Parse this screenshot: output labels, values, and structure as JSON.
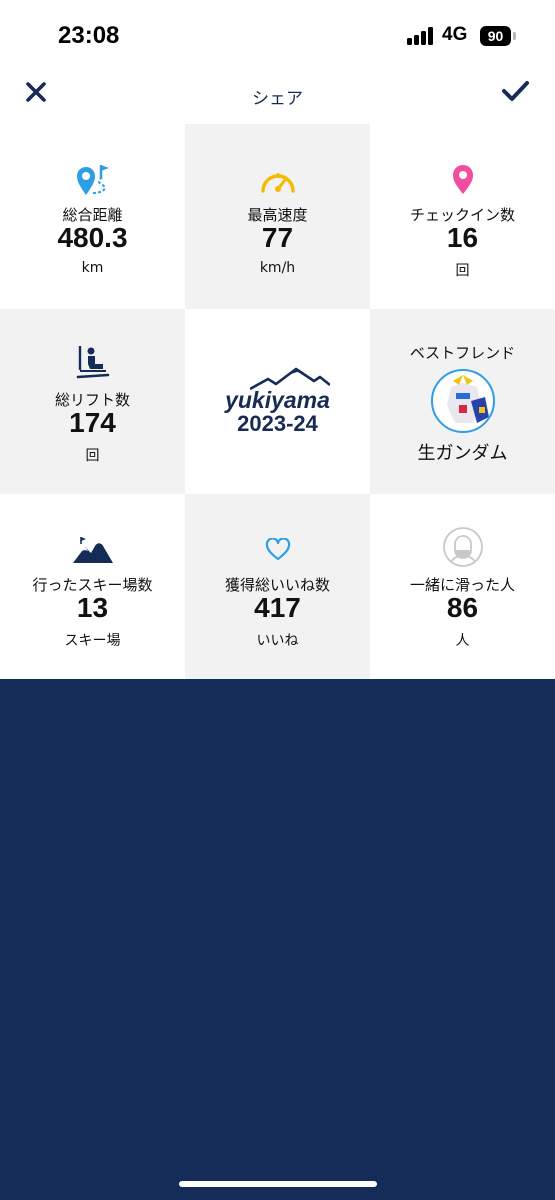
{
  "status_bar": {
    "time": "23:08",
    "network": "4G",
    "battery": "90"
  },
  "nav": {
    "title": "シェア",
    "close_icon": "close-icon",
    "done_icon": "checkmark-icon"
  },
  "stats": {
    "distance": {
      "label": "総合距離",
      "value": "480.3",
      "unit": "km",
      "icon": "route-pin-icon"
    },
    "top_speed": {
      "label": "最高速度",
      "value": "77",
      "unit": "km/h",
      "icon": "speedometer-icon"
    },
    "checkins": {
      "label": "チェックイン数",
      "value": "16",
      "unit": "回",
      "icon": "location-pin-icon"
    },
    "lifts": {
      "label": "総リフト数",
      "value": "174",
      "unit": "回",
      "icon": "ski-lift-icon"
    },
    "resorts": {
      "label": "行ったスキー場数",
      "value": "13",
      "unit": "スキー場",
      "icon": "mountain-icon"
    },
    "likes": {
      "label": "獲得総いいね数",
      "value": "417",
      "unit": "いいね",
      "icon": "heart-icon"
    },
    "companions": {
      "label": "一緒に滑った人",
      "value": "86",
      "unit": "人",
      "icon": "person-icon"
    }
  },
  "logo": {
    "brand": "yukiyama",
    "season": "2023-24"
  },
  "best_friend": {
    "label": "ベストフレンド",
    "name": "生ガンダム"
  },
  "colors": {
    "navy": "#162c58",
    "blue": "#2e9fe6",
    "yellow": "#f6b800",
    "pink": "#ee4da0",
    "gray_bg": "#f2f2f2"
  }
}
